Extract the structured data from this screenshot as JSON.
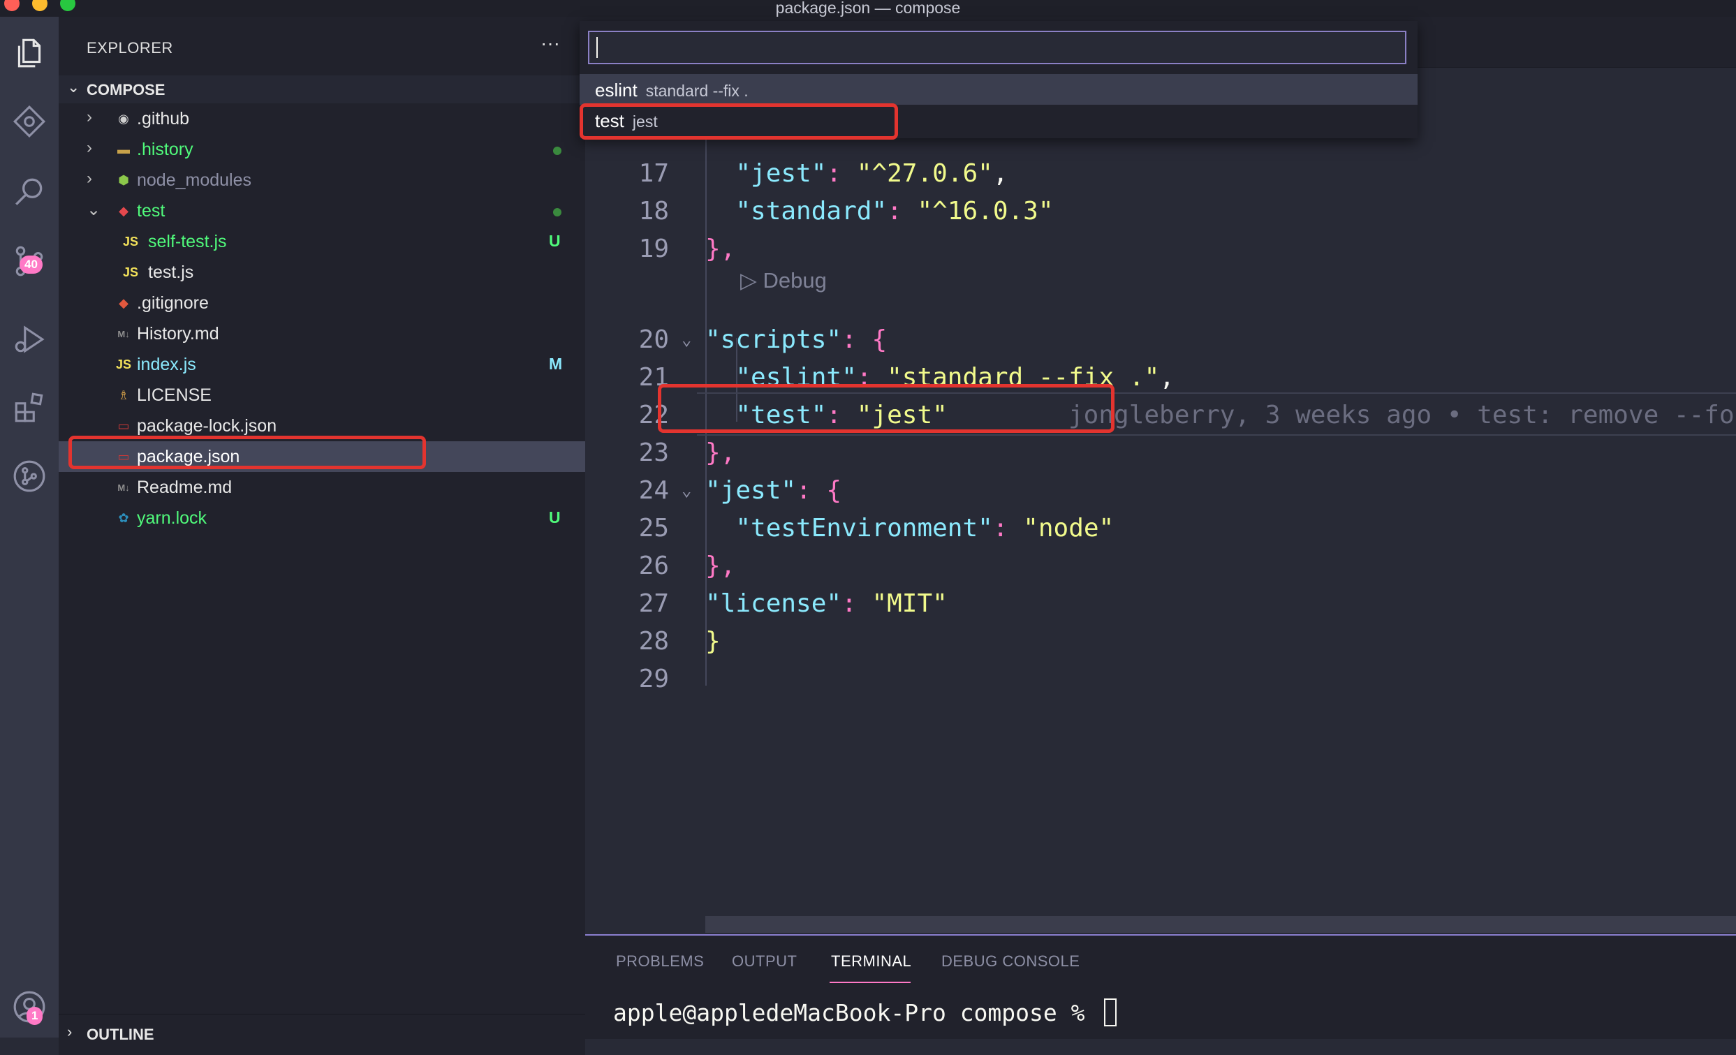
{
  "window": {
    "title": "package.json — compose"
  },
  "activity_bar": {
    "icons": [
      "files-icon",
      "git-graph-icon",
      "search-icon",
      "source-control-icon",
      "run-debug-icon",
      "extensions-icon",
      "gitlens-icon",
      "accounts-icon"
    ],
    "source_control_badge": "40",
    "accounts_badge": "1"
  },
  "sidebar": {
    "explorer_title": "EXPLORER",
    "more_label": "···",
    "section_title": "COMPOSE",
    "outline_title": "OUTLINE",
    "tree": [
      {
        "label": ".github",
        "kind": "folder",
        "chevron": "›",
        "icon": "github-folder-icon",
        "icon_glyph": "◉",
        "icon_color": "#d0d0d0",
        "color": "#e8e8e8",
        "status": ""
      },
      {
        "label": ".history",
        "kind": "folder",
        "chevron": "›",
        "icon": "folder-icon",
        "icon_glyph": "▬",
        "icon_color": "#c8a24a",
        "color": "#50fa7b",
        "status": "dot"
      },
      {
        "label": "node_modules",
        "kind": "folder",
        "chevron": "›",
        "icon": "node-folder-icon",
        "icon_glyph": "⬢",
        "icon_color": "#8cc84b",
        "color": "#8e90a6",
        "status": ""
      },
      {
        "label": "test",
        "kind": "folder-open",
        "chevron": "⌄",
        "icon": "test-folder-icon",
        "icon_glyph": "◆",
        "icon_color": "#e5484d",
        "color": "#50fa7b",
        "status": "dot"
      },
      {
        "label": "self-test.js",
        "kind": "file",
        "icon": "js-file-icon",
        "icon_glyph": "JS",
        "icon_color": "#f1e05a",
        "color": "#50fa7b",
        "status": "U"
      },
      {
        "label": "test.js",
        "kind": "file",
        "icon": "js-file-icon",
        "icon_glyph": "JS",
        "icon_color": "#f1e05a",
        "color": "#e8e8e8",
        "status": ""
      },
      {
        "label": ".gitignore",
        "kind": "file",
        "icon": "git-file-icon",
        "icon_glyph": "◆",
        "icon_color": "#e2583e",
        "color": "#e8e8e8",
        "status": ""
      },
      {
        "label": "History.md",
        "kind": "file",
        "icon": "markdown-file-icon",
        "icon_glyph": "M↓",
        "icon_color": "#8e8e8e",
        "color": "#e8e8e8",
        "status": ""
      },
      {
        "label": "index.js",
        "kind": "file",
        "icon": "js-file-icon",
        "icon_glyph": "JS",
        "icon_color": "#f1e05a",
        "color": "#8be9fd",
        "status": "M"
      },
      {
        "label": "LICENSE",
        "kind": "file",
        "icon": "license-file-icon",
        "icon_glyph": "♗",
        "icon_color": "#e0a84a",
        "color": "#e8e8e8",
        "status": ""
      },
      {
        "label": "package-lock.json",
        "kind": "file",
        "icon": "npm-file-icon",
        "icon_glyph": "▭",
        "icon_color": "#cb3837",
        "color": "#e8e8e8",
        "status": ""
      },
      {
        "label": "package.json",
        "kind": "file",
        "icon": "npm-file-icon",
        "icon_glyph": "▭",
        "icon_color": "#cb3837",
        "color": "#ffffff",
        "status": "",
        "selected": true
      },
      {
        "label": "Readme.md",
        "kind": "file",
        "icon": "markdown-file-icon",
        "icon_glyph": "M↓",
        "icon_color": "#8e8e8e",
        "color": "#e8e8e8",
        "status": ""
      },
      {
        "label": "yarn.lock",
        "kind": "file",
        "icon": "yarn-file-icon",
        "icon_glyph": "✿",
        "icon_color": "#2c8ebb",
        "color": "#50fa7b",
        "status": "U"
      }
    ]
  },
  "quick_pick": {
    "input_value": "",
    "items": [
      {
        "label": "eslint",
        "description": "standard --fix ."
      },
      {
        "label": "test",
        "description": "jest"
      }
    ]
  },
  "editor": {
    "codelens": "▷ Debug",
    "lines": [
      {
        "num": "17",
        "tokens": [
          [
            "w",
            "  "
          ],
          [
            "k",
            "\"jest\""
          ],
          [
            "p",
            ": "
          ],
          [
            "s",
            "\"^27.0.6\""
          ],
          [
            "w",
            ","
          ]
        ]
      },
      {
        "num": "18",
        "tokens": [
          [
            "w",
            "  "
          ],
          [
            "k",
            "\"standard\""
          ],
          [
            "p",
            ": "
          ],
          [
            "s",
            "\"^16.0.3\""
          ]
        ]
      },
      {
        "num": "19",
        "tokens": [
          [
            "p",
            "},"
          ]
        ]
      },
      {
        "num": "20",
        "fold": true,
        "tokens": [
          [
            "k",
            "\"scripts\""
          ],
          [
            "p",
            ": "
          ],
          [
            "p",
            "{"
          ]
        ]
      },
      {
        "num": "21",
        "tokens": [
          [
            "w",
            "  "
          ],
          [
            "k",
            "\"eslint\""
          ],
          [
            "p",
            ": "
          ],
          [
            "s",
            "\"standard --fix .\""
          ],
          [
            "w",
            ","
          ]
        ]
      },
      {
        "num": "22",
        "tokens": [
          [
            "w",
            "  "
          ],
          [
            "k",
            "\"test\""
          ],
          [
            "p",
            ": "
          ],
          [
            "s",
            "\"jest\""
          ]
        ],
        "blame": "jongleberry, 3 weeks ago • test: remove --fo"
      },
      {
        "num": "23",
        "tokens": [
          [
            "p",
            "},"
          ]
        ]
      },
      {
        "num": "24",
        "fold": true,
        "tokens": [
          [
            "k",
            "\"jest\""
          ],
          [
            "p",
            ": "
          ],
          [
            "p",
            "{"
          ]
        ]
      },
      {
        "num": "25",
        "tokens": [
          [
            "w",
            "  "
          ],
          [
            "k",
            "\"testEnvironment\""
          ],
          [
            "p",
            ": "
          ],
          [
            "s",
            "\"node\""
          ]
        ]
      },
      {
        "num": "26",
        "tokens": [
          [
            "p",
            "},"
          ]
        ]
      },
      {
        "num": "27",
        "tokens": [
          [
            "k",
            "\"license\""
          ],
          [
            "p",
            ": "
          ],
          [
            "s",
            "\"MIT\""
          ]
        ]
      },
      {
        "num": "28",
        "tokens": [
          [
            "y",
            "}"
          ]
        ]
      },
      {
        "num": "29",
        "tokens": []
      }
    ]
  },
  "panel": {
    "tabs": [
      {
        "label": "PROBLEMS",
        "active": false
      },
      {
        "label": "OUTPUT",
        "active": false
      },
      {
        "label": "TERMINAL",
        "active": true
      },
      {
        "label": "DEBUG CONSOLE",
        "active": false
      }
    ],
    "terminal_prompt": "apple@appledeMacBook-Pro compose % "
  },
  "colors": {
    "accent": "#ff79c6",
    "annotation_red": "#e3342f",
    "git_green": "#50fa7b"
  }
}
